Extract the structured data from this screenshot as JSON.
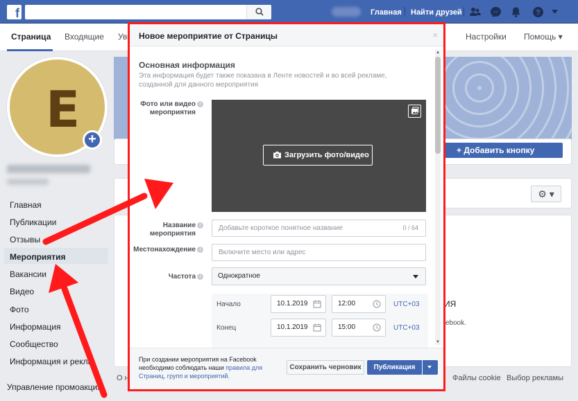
{
  "topbar": {
    "links": [
      "Главная",
      "Найти друзей"
    ]
  },
  "page_nav": {
    "tabs": [
      "Страница",
      "Входящие",
      "Уве"
    ],
    "right": [
      "Настройки",
      "Помощь ▾"
    ]
  },
  "profile": {
    "letter": "E",
    "add_photo_glyph": "+"
  },
  "sidebar": {
    "items": [
      "Главная",
      "Публикации",
      "Отзывы",
      "Мероприятия",
      "Вакансии",
      "Видео",
      "Фото",
      "Информация",
      "Сообщество",
      "Информация и рекла"
    ],
    "active_index": 3,
    "promo": "Управление промоакция"
  },
  "main": {
    "add_button": "+ Добавить кнопку",
    "gear_label": "⚙ ▾",
    "right_frag_1": "ИЯ",
    "right_frag_2": "ebook.",
    "footer_links": [
      "О на",
      "Файлы cookie",
      "Выбор рекламы"
    ]
  },
  "modal": {
    "title": "Новое мероприятие от Страницы",
    "close": "×",
    "section_title": "Основная информация",
    "section_desc": "Эта информация будет также показана в Ленте новостей и во всей рекламе, созданной для данного мероприятия",
    "photo_label": "Фото или видео мероприятия",
    "upload_button": "Загрузить фото/видео",
    "name_label": "Название мероприятия",
    "name_placeholder": "Добавьте короткое понятное название",
    "name_counter": "0 / 64",
    "location_label": "Местонахождение",
    "location_placeholder": "Включите место или адрес",
    "frequency_label": "Частота",
    "frequency_value": "Однократное",
    "start_label": "Начало",
    "start_date": "10.1.2019",
    "start_time": "12:00",
    "end_label": "Конец",
    "end_date": "10.1.2019",
    "end_time": "15:00",
    "timezone": "UTC+03",
    "footer_note_1": "При создании мероприятия на Facebook необходимо соблюдать наши ",
    "footer_note_link": "правила для Страниц, групп и мероприятий.",
    "draft_button": "Сохранить черновик",
    "publish_button": "Публикация"
  },
  "colors": {
    "brand_blue": "#4267b2",
    "highlight_red": "#ff1b1b"
  }
}
